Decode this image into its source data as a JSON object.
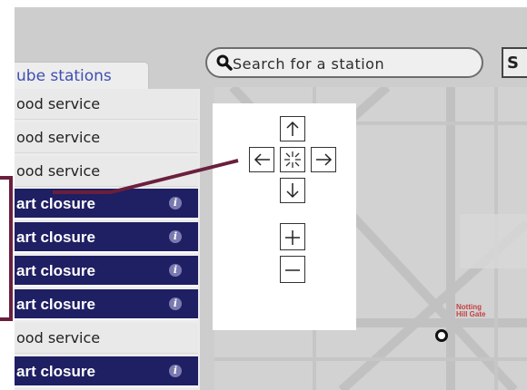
{
  "sidebar": {
    "tab_label": "ube stations",
    "rows": [
      {
        "status_text": "ood service",
        "kind": "good"
      },
      {
        "status_text": "ood service",
        "kind": "good"
      },
      {
        "status_text": "ood service",
        "kind": "good"
      },
      {
        "status_text": "art closure",
        "kind": "closure",
        "info_icon": "info-icon"
      },
      {
        "status_text": "art closure",
        "kind": "closure",
        "info_icon": "info-icon"
      },
      {
        "status_text": "art closure",
        "kind": "closure",
        "info_icon": "info-icon"
      },
      {
        "status_text": "art closure",
        "kind": "closure",
        "info_icon": "info-icon"
      },
      {
        "status_text": "ood service",
        "kind": "good"
      },
      {
        "status_text": "art closure",
        "kind": "closure",
        "info_icon": "info-icon"
      }
    ]
  },
  "search": {
    "placeholder": "Search for a station",
    "button_label": "S",
    "icon": "magnifier-icon"
  },
  "map_controls": {
    "pan_up": "arrow-up-icon",
    "pan_left": "arrow-left-icon",
    "center": "center-icon",
    "pan_right": "arrow-right-icon",
    "pan_down": "arrow-down-icon",
    "zoom_in": "plus-icon",
    "zoom_out": "minus-icon"
  },
  "map": {
    "station_name": "Notting Hill Gate",
    "station_name_line1": "Notting",
    "station_name_line2": "Hill Gate"
  },
  "colors": {
    "closure_row_bg": "#1f1f63",
    "callout_line": "#6a1f3e",
    "tab_text": "#3e4fb2",
    "station_label": "#c44040"
  }
}
